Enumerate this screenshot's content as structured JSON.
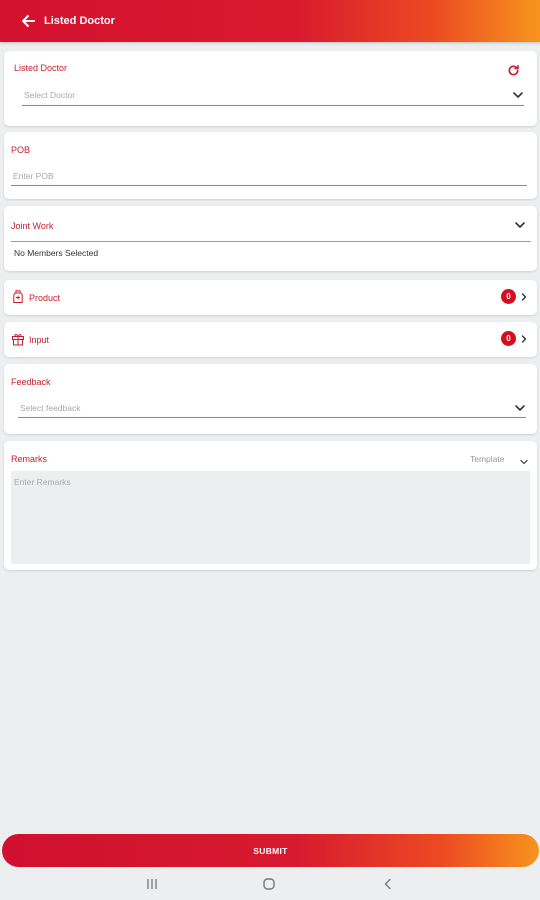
{
  "appbar": {
    "title": "Listed Doctor"
  },
  "doctor_card": {
    "label": "Listed Doctor",
    "placeholder": "Select Doctor"
  },
  "pob_card": {
    "label": "POB",
    "placeholder": "Enter POB"
  },
  "joint_work_card": {
    "label": "Joint Work",
    "value": "No Members Selected"
  },
  "product_row": {
    "label": "Product",
    "count": "0"
  },
  "input_row": {
    "label": "Input",
    "count": "0"
  },
  "feedback_card": {
    "label": "Feedback",
    "placeholder": "Select feedback"
  },
  "remarks_card": {
    "label": "Remarks",
    "template_label": "Template",
    "placeholder": "Enter Remarks"
  },
  "submit": {
    "label": "SUBMIT"
  },
  "colors": {
    "primary_red": "#d0101f",
    "gradient_end": "#f7941d",
    "label_red": "#c81e2d",
    "background": "#eceeef"
  },
  "icons": {
    "back": "arrow-left-icon",
    "refresh": "refresh-icon",
    "chevron_down": "chevron-down-icon",
    "chevron_right": "chevron-right-icon",
    "product": "product-bottle-icon",
    "input": "gift-icon",
    "nav_recents": "recents-icon",
    "nav_home": "home-icon",
    "nav_back": "nav-back-icon"
  }
}
